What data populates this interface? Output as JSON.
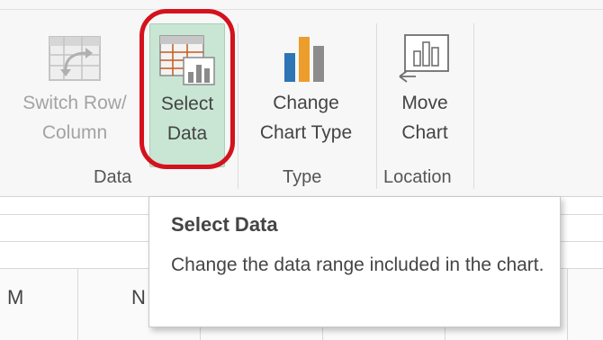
{
  "ribbon": {
    "buttons": [
      {
        "line1": "Switch Row/",
        "line2": "Column",
        "icon": "switch-row-column-icon",
        "enabled": false
      },
      {
        "line1": "Select",
        "line2": "Data",
        "icon": "select-data-icon",
        "enabled": true,
        "highlighted": true
      },
      {
        "line1": "Change",
        "line2": "Chart Type",
        "icon": "change-chart-type-icon",
        "enabled": true
      },
      {
        "line1": "Move",
        "line2": "Chart",
        "icon": "move-chart-icon",
        "enabled": true
      }
    ],
    "groups": [
      "Data",
      "Type",
      "Location"
    ]
  },
  "worksheet": {
    "column_headers": [
      "M",
      "N"
    ]
  },
  "tooltip": {
    "title": "Select Data",
    "description": "Change the data range included in the chart."
  },
  "colors": {
    "highlight_ring": "#d4121d",
    "selected_button_bg": "#c9e6d4",
    "bar_blue": "#2e75b6",
    "bar_orange": "#ed9d2b",
    "bar_gray": "#8c8c8c"
  }
}
